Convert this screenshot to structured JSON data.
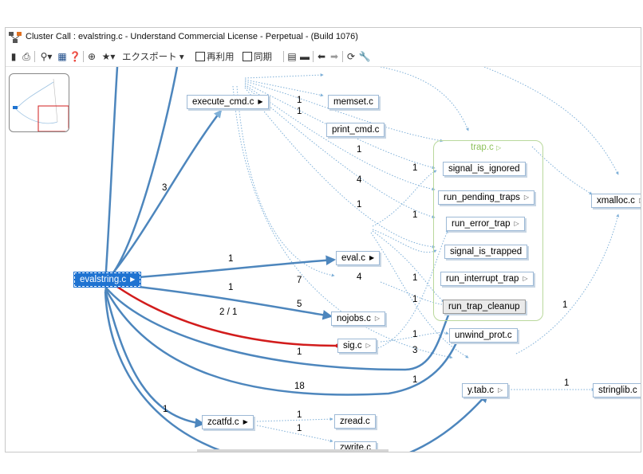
{
  "window": {
    "title": "Cluster Call : evalstring.c - Understand Commercial License - Perpetual - (Build 1076)"
  },
  "toolbar": {
    "export_label": "エクスポート",
    "reuse_label": "再利用",
    "sync_label": "同期"
  },
  "nodes": {
    "execute_cmd": "execute_cmd.c",
    "memset": "memset.c",
    "print_cmd": "print_cmd.c",
    "evalstring": "evalstring.c",
    "eval": "eval.c",
    "nojobs": "nojobs.c",
    "sig": "sig.c",
    "zcatfd": "zcatfd.c",
    "zread": "zread.c",
    "zwrite": "zwrite.c",
    "ytab": "y.tab.c",
    "stringlib": "stringlib.c",
    "xmalloc": "xmalloc.c",
    "unwind_prot": "unwind_prot.c"
  },
  "cluster": {
    "label": "trap.c",
    "items": [
      "signal_is_ignored",
      "run_pending_traps",
      "run_error_trap",
      "signal_is_trapped",
      "run_interrupt_trap",
      "run_trap_cleanup"
    ]
  },
  "edge_labels": {
    "exec_memset": "1",
    "exec_print": "1",
    "l_1a": "1",
    "l_4a": "4",
    "l_1b": "1",
    "l_3": "3",
    "l_1c": "1",
    "l_1d": "1",
    "eval_to_eval": "1",
    "l_7": "7",
    "l_4b": "4",
    "l_1e": "1",
    "eval_to_nojobs": "1",
    "l_5": "5",
    "l_1f": "1",
    "red_label": "2 / 1",
    "l_1g": "1",
    "l_3b": "3",
    "l_1h": "1",
    "l_18": "18",
    "l_1i": "1",
    "l_1j": "1",
    "l_1k": "1",
    "l_1l": "1",
    "l_1m": "1",
    "l_3c": "3"
  },
  "colors": {
    "edge_main": "#4d86bd",
    "edge_dotted": "#7fb0d8",
    "edge_red": "#d21c1c",
    "cluster_border": "#b9d89c",
    "cluster_label": "#8fc25e",
    "selected_bg": "#1f73d1"
  },
  "icons": [
    "app-graph-icon",
    "copy-icon",
    "print-icon",
    "zoom-icon",
    "map-icon",
    "help-icon",
    "magnify-icon",
    "star-icon",
    "layout-icon",
    "folder-icon",
    "back-icon",
    "forward-icon",
    "refresh-icon",
    "wrench-icon"
  ]
}
